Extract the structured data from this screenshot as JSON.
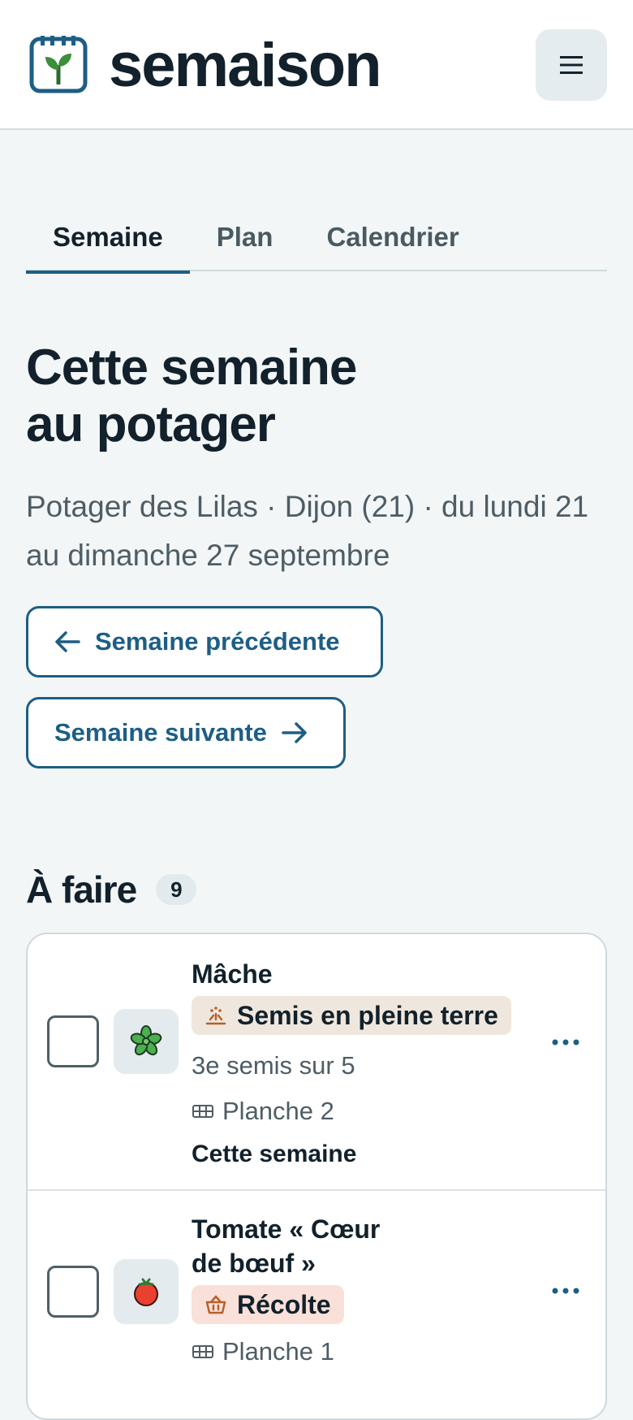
{
  "header": {
    "brand": "semaison"
  },
  "tabs": [
    {
      "label": "Semaine"
    },
    {
      "label": "Plan"
    },
    {
      "label": "Calendrier"
    }
  ],
  "page": {
    "title_line1": "Cette semaine",
    "title_line2": "au potager",
    "subtitle": "Potager des Lilas · Dijon (21) · du lundi 21 au dimanche 27 septembre",
    "prev_label": "Semaine précédente",
    "next_label": "Semaine suivante"
  },
  "todo": {
    "title": "À faire",
    "count": "9",
    "tasks": [
      {
        "name": "Mâche",
        "chip": "Semis en pleine terre",
        "detail": "3e semis sur 5",
        "bed": "Planche 2",
        "due": "Cette semaine",
        "icon": "lettuce-icon"
      },
      {
        "name_line1": "Tomate « Cœur",
        "name_line2": "de bœuf »",
        "chip": "Récolte",
        "bed": "Planche 1",
        "icon": "tomato-icon"
      }
    ]
  },
  "colors": {
    "accent": "#1d5e84",
    "background": "#f3f6f7",
    "text": "#12212b",
    "muted": "#4e5d65"
  }
}
